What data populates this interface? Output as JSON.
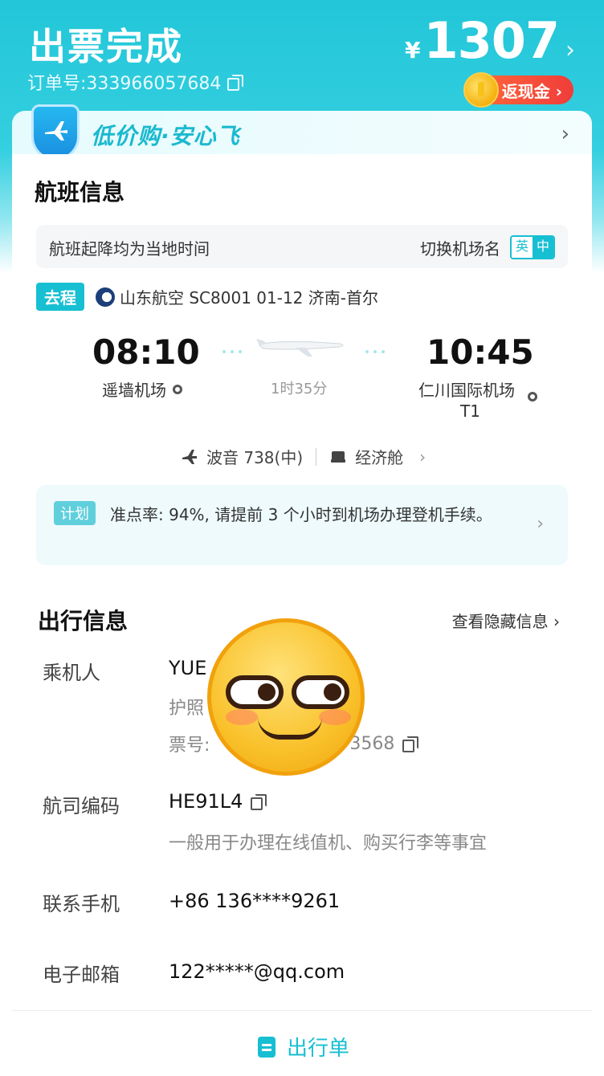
{
  "header": {
    "title": "出票完成",
    "order_label": "订单号:333966057684",
    "currency": "¥",
    "price": "1307",
    "price_chevron": "›",
    "cashback": "返现金 ›"
  },
  "banner": {
    "text": "低价购·安心飞",
    "chevron": "›"
  },
  "flight_info": {
    "title": "航班信息",
    "local_time_note": "航班起降均为当地时间",
    "switch_airport_name": "切换机场名",
    "lang_en": "英",
    "lang_zh": "中",
    "trip_tag": "去程",
    "airline_line": "山东航空 SC8001   01-12 济南-首尔",
    "dep_time": "08:10",
    "dep_airport": "遥墙机场",
    "duration": "1时35分",
    "arr_time": "10:45",
    "arr_airport": "仁川国际机场",
    "arr_terminal": "T1",
    "aircraft": "波音 738(中)",
    "cabin": "经济舱",
    "aircraft_chevron": "›",
    "notice_tag": "计划",
    "notice_text": "准点率: 94%, 请提前 3 个小时到机场办理登机手续。",
    "notice_chevron": "›"
  },
  "travel_info": {
    "title": "出行信息",
    "view_hidden": "查看隐藏信息 ›",
    "passenger_label": "乘机人",
    "passenger_name": "YUE",
    "passport_label": "护照",
    "ticket_label": "票号:",
    "ticket_suffix": "73568",
    "pnr_label": "航司编码",
    "pnr_value": "HE91L4",
    "pnr_note": "一般用于办理在线值机、购买行李等事宜",
    "phone_label": "联系手机",
    "phone_value": "+86 136****9261",
    "email_label": "电子邮箱",
    "email_value": "122*****@qq.com"
  },
  "footer": {
    "itinerary_button": "出行单"
  },
  "colors": {
    "accent": "#17bfd2",
    "header": "#22c6d8",
    "cashback": "#f03c3a"
  }
}
